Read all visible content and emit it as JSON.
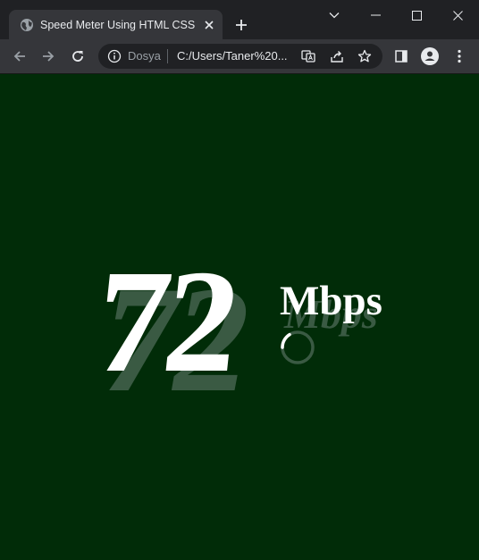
{
  "browser": {
    "tab_title": "Speed Meter Using HTML CSS Js",
    "omnibox": {
      "scheme_label": "Dosya",
      "url": "C:/Users/Taner%20..."
    },
    "icons": {
      "tab_favicon": "globe-icon",
      "tab_close": "close-icon",
      "new_tab": "plus-icon",
      "tab_search": "chevron-down-icon",
      "minimize": "minimize-icon",
      "maximize": "maximize-icon",
      "close_window": "close-icon",
      "back": "arrow-left-icon",
      "forward": "arrow-right-icon",
      "reload": "reload-icon",
      "info": "info-icon",
      "translate": "translate-icon",
      "share": "share-icon",
      "bookmark": "star-icon",
      "side_panel": "side-panel-icon",
      "profile": "profile-icon",
      "menu": "kebab-menu-icon"
    }
  },
  "page": {
    "speed_value": "72",
    "unit": "Mbps",
    "loader_icon": "loading-spinner-icon"
  },
  "colors": {
    "page_background": "#012c08",
    "text": "#ffffff",
    "text_shadow": "#3a5a43",
    "browser_frame": "#202124",
    "toolbar": "#35363a"
  }
}
